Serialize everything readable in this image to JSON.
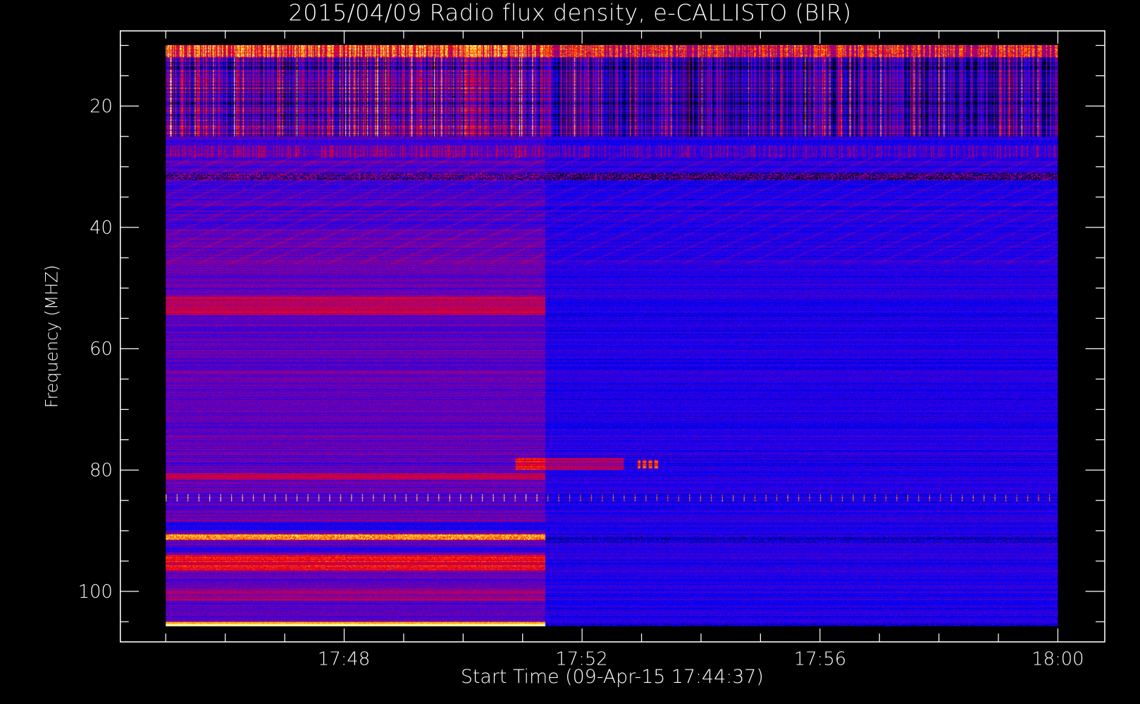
{
  "chart_data": {
    "type": "heatmap",
    "title": "2015/04/09  Radio flux density, e-CALLISTO (BIR)",
    "xlabel": "Start Time (09-Apr-15 17:44:37)",
    "ylabel": "Frequency (MHZ)",
    "x_tick_labels": [
      "17:48",
      "17:52",
      "17:56",
      "18:00"
    ],
    "x_ticks_minutes": [
      3.383,
      7.383,
      11.383,
      15.383
    ],
    "y_tick_labels": [
      "20",
      "40",
      "60",
      "80",
      "100"
    ],
    "y_ticks": [
      20,
      40,
      60,
      80,
      100
    ],
    "xlim_minutes_from_start": [
      -0.38,
      16.17
    ],
    "data_time_range": [
      "17:45:00",
      "18:00:00"
    ],
    "ylim": [
      108.3,
      7.5
    ],
    "data_freq_range_mhz": [
      10,
      105.7
    ],
    "y_inverted": true,
    "colormap": [
      "#000000",
      "#0000ff",
      "#8a0070",
      "#ff0000",
      "#ffa000",
      "#ffff60",
      "#ffffff"
    ],
    "instrument_change_time": "17:51:20",
    "features": [
      {
        "name": "strong interference top",
        "freq_mhz": 11,
        "start": "17:45",
        "end": "18:00",
        "level": "high"
      },
      {
        "name": "shortwave broadcast band",
        "freq_mhz_range": [
          13,
          25
        ],
        "start": "17:45",
        "end": "18:00",
        "level": "medium-high"
      },
      {
        "name": "broadband band",
        "freq_mhz": 27.5,
        "start": "17:45",
        "end": "18:00",
        "level": "medium"
      },
      {
        "name": "dark/red band",
        "freq_mhz": 31.5,
        "start": "17:45",
        "end": "18:00",
        "level": "mixed"
      },
      {
        "name": "band",
        "freq_mhz": 52.5,
        "start": "17:45",
        "end": "17:51:20",
        "level": "medium"
      },
      {
        "name": "short burst",
        "freq_mhz": 79,
        "start": "17:51",
        "end": "17:53",
        "level": "high"
      },
      {
        "name": "band",
        "freq_mhz": 81,
        "start": "17:45",
        "end": "17:51:20",
        "level": "medium"
      },
      {
        "name": "periodic spikes",
        "freq_mhz": 84.5,
        "start": "17:45",
        "end": "18:00",
        "level": "high"
      },
      {
        "name": "band",
        "freq_mhz": 91,
        "start": "17:45",
        "end": "17:51:20",
        "level": "high"
      },
      {
        "name": "band",
        "freq_mhz": 95,
        "start": "17:45",
        "end": "17:51:20",
        "level": "medium-high"
      },
      {
        "name": "saturated edge",
        "freq_mhz": 105.5,
        "start": "17:45",
        "end": "17:51:20",
        "level": "saturated"
      }
    ]
  }
}
